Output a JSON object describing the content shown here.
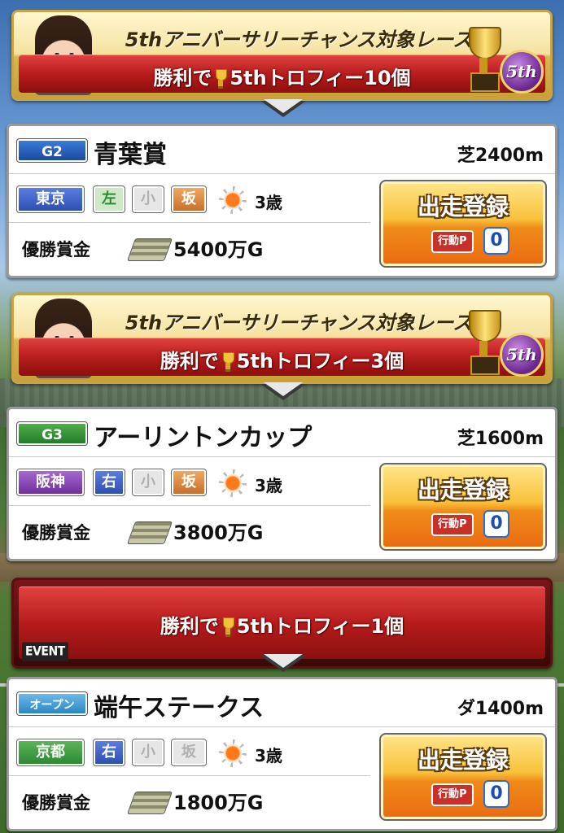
{
  "races": [
    {
      "banner": {
        "title": "5thアニバーサリーチャンス対象レース",
        "reward_prefix": "勝利で",
        "reward_text": "5thトロフィー10個",
        "badge": "5th"
      },
      "grade": "G2",
      "name": "青葉賞",
      "distance": "芝2400m",
      "tags": [
        "東京",
        "左",
        "小",
        "坂"
      ],
      "age": "3歳",
      "prize_label": "優勝賞金",
      "prize": "5400万G",
      "entry_label": "出走登録",
      "ap_label": "行動P",
      "ap_value": "0"
    },
    {
      "banner": {
        "title": "5thアニバーサリーチャンス対象レース",
        "reward_prefix": "勝利で",
        "reward_text": "5thトロフィー3個",
        "badge": "5th"
      },
      "grade": "G3",
      "name": "アーリントンカップ",
      "distance": "芝1600m",
      "tags": [
        "阪神",
        "右",
        "小",
        "坂"
      ],
      "age": "3歳",
      "prize_label": "優勝賞金",
      "prize": "3800万G",
      "entry_label": "出走登録",
      "ap_label": "行動P",
      "ap_value": "0"
    },
    {
      "banner": {
        "event_tag": "EVENT",
        "reward_prefix": "勝利で",
        "reward_text": "5thトロフィー1個"
      },
      "grade": "オープン",
      "name": "端午ステークス",
      "distance": "ダ1400m",
      "tags": [
        "京都",
        "右",
        "小",
        "坂"
      ],
      "age": "3歳",
      "prize_label": "優勝賞金",
      "prize": "1800万G",
      "entry_label": "出走登録",
      "ap_label": "行動P",
      "ap_value": "0"
    }
  ],
  "colors": {
    "accent_red": "#b81c1c",
    "gold": "#c9a447",
    "entry_orange": "#f08b1a"
  }
}
